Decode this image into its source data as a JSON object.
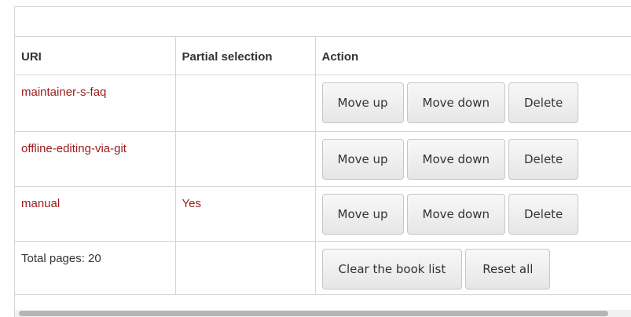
{
  "headers": {
    "uri": "URI",
    "partial": "Partial selection",
    "action": "Action"
  },
  "rows": [
    {
      "uri": "maintainer-s-faq",
      "partial": "",
      "move_up": "Move up",
      "move_down": "Move down",
      "delete": "Delete"
    },
    {
      "uri": "offline-editing-via-git",
      "partial": "",
      "move_up": "Move up",
      "move_down": "Move down",
      "delete": "Delete"
    },
    {
      "uri": "manual",
      "partial": "Yes",
      "move_up": "Move up",
      "move_down": "Move down",
      "delete": "Delete"
    }
  ],
  "footer": {
    "total": "Total pages: 20",
    "clear_label": "Clear the book list",
    "reset_label": "Reset all"
  },
  "colors": {
    "link": "#9b1b1b",
    "border": "#d4d4d4",
    "text": "#333333"
  }
}
